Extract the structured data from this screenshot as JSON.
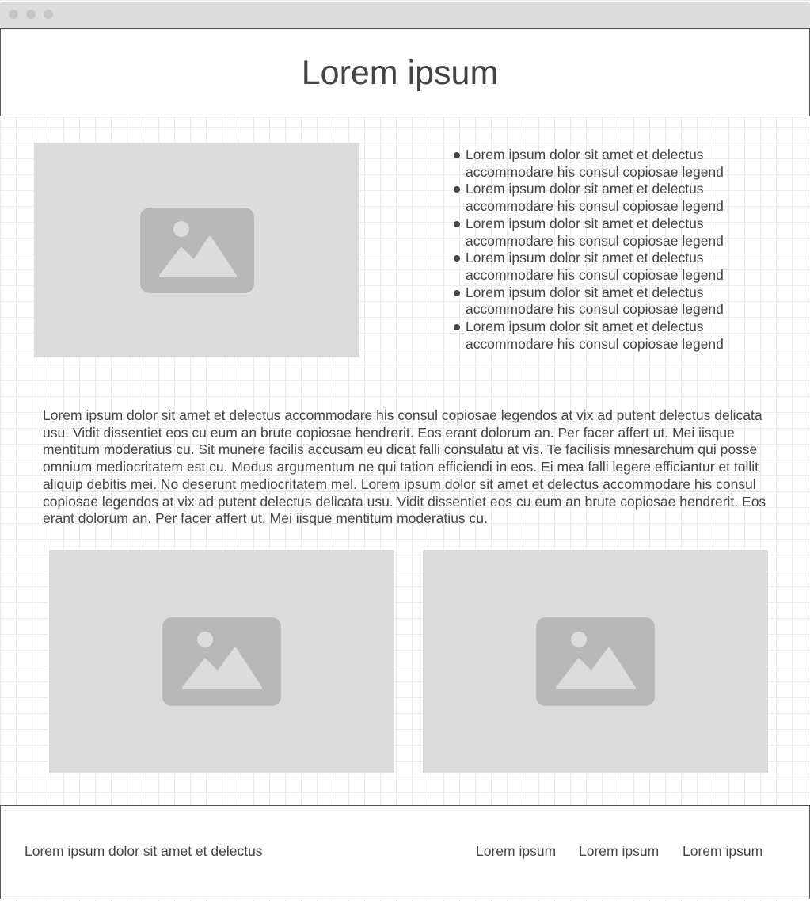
{
  "header": {
    "title": "Lorem ipsum"
  },
  "hero_image": {
    "icon": "image-placeholder-icon"
  },
  "bullets": [
    "Lorem ipsum dolor sit amet et delectus accommodare his consul copiosae legend",
    "Lorem ipsum dolor sit amet et delectus accommodare his consul copiosae legend",
    "Lorem ipsum dolor sit amet et delectus accommodare his consul copiosae legend",
    "Lorem ipsum dolor sit amet et delectus accommodare his consul copiosae legend",
    "Lorem ipsum dolor sit amet et delectus accommodare his consul copiosae legend",
    "Lorem ipsum dolor sit amet et delectus accommodare his consul copiosae legend"
  ],
  "body": {
    "paragraph": "Lorem ipsum dolor sit amet et delectus accommodare his consul copiosae legendos at vix ad putent delectus delicata usu. Vidit dissentiet eos cu eum an brute copiosae hendrerit. Eos erant dolorum an. Per facer affert ut. Mei iisque mentitum moderatius cu. Sit munere facilis accusam eu dicat falli consulatu at vis. Te facilisis mnesarchum qui posse omnium mediocritatem est cu. Modus argumentum ne qui tation efficiendi in eos. Ei mea falli legere efficiantur et tollit aliquip debitis mei. No deserunt mediocritatem mel. Lorem ipsum dolor sit amet et delectus accommodare his consul copiosae legendos at vix ad putent delectus delicata usu. Vidit dissentiet eos cu eum an brute copiosae hendrerit. Eos erant dolorum an. Per facer affert ut. Mei iisque mentitum moderatius cu."
  },
  "gallery": {
    "icon": "image-placeholder-icon"
  },
  "footer": {
    "text": "Lorem ipsum dolor sit amet et delectus",
    "links": [
      "Lorem ipsum",
      "Lorem ipsum",
      "Lorem ipsum"
    ]
  },
  "colors": {
    "text": "#444444",
    "placeholder_bg": "#dcdcdc",
    "placeholder_icon": "#b8b8b8",
    "border": "#555555"
  }
}
